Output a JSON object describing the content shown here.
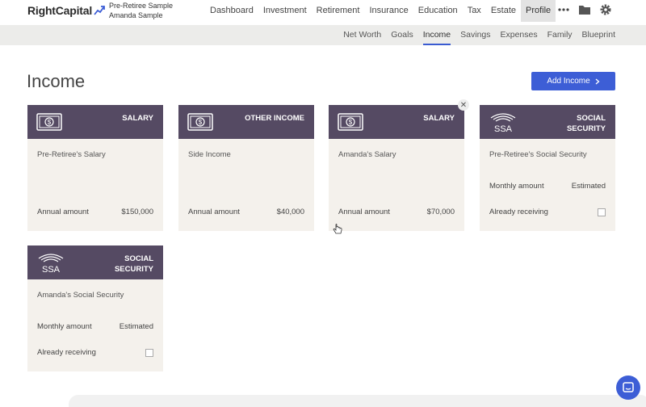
{
  "brand": {
    "name": "RightCapital"
  },
  "clients": {
    "primary": "Pre-Retiree Sample",
    "secondary": "Amanda Sample"
  },
  "nav": {
    "items": [
      "Dashboard",
      "Investment",
      "Retirement",
      "Insurance",
      "Education",
      "Tax",
      "Estate",
      "Profile"
    ],
    "active": "Profile"
  },
  "tools": {
    "more_icon": "more-icon",
    "folder_icon": "folder-icon",
    "settings_icon": "gear-icon"
  },
  "subnav": {
    "items": [
      "Net Worth",
      "Goals",
      "Income",
      "Savings",
      "Expenses",
      "Family",
      "Blueprint"
    ],
    "active": "Income"
  },
  "page": {
    "title": "Income",
    "add_label": "Add Income"
  },
  "cards": [
    {
      "kind": "SALARY",
      "icon": "dollar-bill-icon",
      "name": "Pre-Retiree's Salary",
      "rows": [
        {
          "label": "Annual amount",
          "value": "$150,000"
        }
      ]
    },
    {
      "kind": "OTHER INCOME",
      "icon": "dollar-bill-icon",
      "name": "Side Income",
      "rows": [
        {
          "label": "Annual amount",
          "value": "$40,000"
        }
      ]
    },
    {
      "kind": "SALARY",
      "icon": "dollar-bill-icon",
      "name": "Amanda's Salary",
      "rows": [
        {
          "label": "Annual amount",
          "value": "$70,000"
        }
      ]
    },
    {
      "kind": "SOCIAL SECURITY",
      "icon": "ssa-logo-icon",
      "name": "Pre-Retiree's Social Security",
      "rows": [
        {
          "label": "Monthly amount",
          "value": "Estimated"
        },
        {
          "label": "Already receiving",
          "checkbox": false
        }
      ]
    },
    {
      "kind": "SOCIAL SECURITY",
      "icon": "ssa-logo-icon",
      "name": "Amanda's Social Security",
      "rows": [
        {
          "label": "Monthly amount",
          "value": "Estimated"
        },
        {
          "label": "Already receiving",
          "checkbox": false
        }
      ]
    }
  ],
  "colors": {
    "accent": "#3d5ed6",
    "card_header": "#554a63",
    "card_body": "#f4f1ec",
    "subnav_bg": "#ececea"
  }
}
